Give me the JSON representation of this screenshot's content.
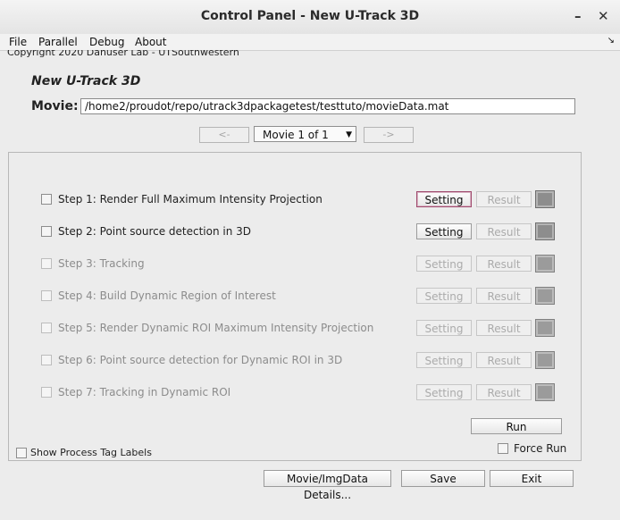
{
  "window": {
    "title": "Control Panel - New U-Track 3D",
    "minimize_glyph": "–",
    "close_glyph": "✕"
  },
  "menu": {
    "items": [
      "File",
      "Parallel",
      "Debug",
      "About"
    ],
    "overflow_glyph": "↘"
  },
  "header": {
    "copyright": "Copyright 2020 Danuser Lab - UTSouthwestern",
    "app_title": "New U-Track 3D",
    "movie_label": "Movie:",
    "movie_path": "/home2/proudot/repo/utrack3dpackagetest/testtuto/movieData.mat"
  },
  "navigation": {
    "prev_label": "<-",
    "next_label": "->",
    "movie_selected": "Movie 1 of 1"
  },
  "steps": [
    {
      "label": "Step 1: Render Full Maximum Intensity Projection",
      "setting": "Setting",
      "result": "Result",
      "enabled": true
    },
    {
      "label": "Step 2: Point source detection in 3D",
      "setting": "Setting",
      "result": "Result",
      "enabled": true
    },
    {
      "label": "Step 3: Tracking",
      "setting": "Setting",
      "result": "Result",
      "enabled": false
    },
    {
      "label": "Step 4: Build Dynamic Region of Interest",
      "setting": "Setting",
      "result": "Result",
      "enabled": false
    },
    {
      "label": "Step 5: Render Dynamic ROI Maximum Intensity Projection",
      "setting": "Setting",
      "result": "Result",
      "enabled": false
    },
    {
      "label": "Step 6: Point source detection for Dynamic ROI in 3D",
      "setting": "Setting",
      "result": "Result",
      "enabled": false
    },
    {
      "label": "Step 7: Tracking in Dynamic ROI",
      "setting": "Setting",
      "result": "Result",
      "enabled": false
    }
  ],
  "panel": {
    "run_label": "Run",
    "force_run_label": "Force Run",
    "show_tags_label": "Show Process Tag Labels"
  },
  "footer": {
    "details_label": "Movie/ImgData Details...",
    "save_label": "Save",
    "exit_label": "Exit"
  },
  "colors": {
    "focus_border": "#a04b6e",
    "status_gray": "#8d8d8d"
  }
}
